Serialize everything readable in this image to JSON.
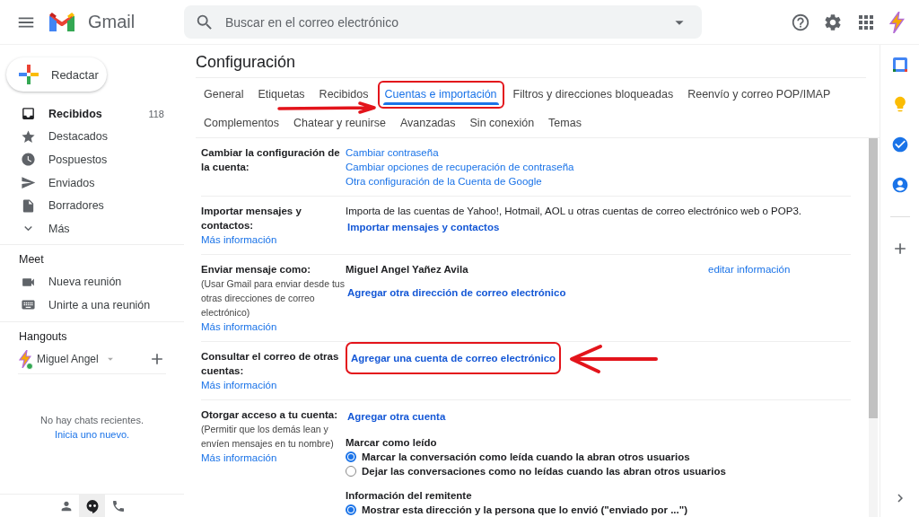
{
  "header": {
    "brand": "Gmail",
    "search": {
      "placeholder": "Buscar en el correo electrónico"
    }
  },
  "sidebar": {
    "compose": "Redactar",
    "items": [
      {
        "label": "Recibidos",
        "count": "118",
        "selected": true
      },
      {
        "label": "Destacados",
        "selected": false
      },
      {
        "label": "Pospuestos",
        "selected": false
      },
      {
        "label": "Enviados",
        "selected": false
      },
      {
        "label": "Borradores",
        "selected": false
      },
      {
        "label": "Más",
        "selected": false
      }
    ],
    "meet": {
      "title": "Meet",
      "items": [
        "Nueva reunión",
        "Unirte a una reunión"
      ]
    },
    "hangouts": {
      "title": "Hangouts",
      "user": "Miguel Angel",
      "online": true,
      "empty": "No hay chats recientes.",
      "start_link": "Inicia uno nuevo."
    },
    "bottom_tabs": [
      {
        "selected": false
      },
      {
        "selected": true
      },
      {
        "selected": false
      }
    ]
  },
  "page_title": "Configuración",
  "tab_rows": [
    [
      {
        "label": "General",
        "selected": false,
        "highlighted": false
      },
      {
        "label": "Etiquetas",
        "selected": false,
        "highlighted": false
      },
      {
        "label": "Recibidos",
        "selected": false,
        "highlighted": false
      },
      {
        "label": "Cuentas e importación",
        "selected": true,
        "highlighted": true
      },
      {
        "label": "Filtros y direcciones bloqueadas",
        "selected": false,
        "highlighted": false
      },
      {
        "label": "Reenvío y correo POP/IMAP",
        "selected": false,
        "highlighted": false
      }
    ],
    [
      {
        "label": "Complementos",
        "selected": false,
        "highlighted": false
      },
      {
        "label": "Chatear y reunirse",
        "selected": false,
        "highlighted": false
      },
      {
        "label": "Avanzadas",
        "selected": false,
        "highlighted": false
      },
      {
        "label": "Sin conexión",
        "selected": false,
        "highlighted": false
      },
      {
        "label": "Temas",
        "selected": false,
        "highlighted": false
      }
    ]
  ],
  "settings": [
    {
      "label": "Cambiar la configuración de la cuenta:",
      "values": [
        {
          "kind": "link",
          "text": "Cambiar contraseña"
        },
        {
          "kind": "link",
          "text": "Cambiar opciones de recuperación de contraseña"
        },
        {
          "kind": "link",
          "text": "Otra configuración de la Cuenta de Google"
        }
      ]
    },
    {
      "label": "Importar mensajes y contactos:",
      "more": "Más información",
      "values": [
        {
          "kind": "text",
          "text": "Importa de las cuentas de Yahoo!, Hotmail, AOL u otras cuentas de correo electrónico web o POP3."
        },
        {
          "kind": "strong_link",
          "text": "Importar mensajes y contactos"
        }
      ]
    },
    {
      "label": "Enviar mensaje como:",
      "note": "(Usar Gmail para enviar desde tus otras direcciones de correo electrónico)",
      "more": "Más información",
      "values": [
        {
          "kind": "sender",
          "text": "Miguel Angel Yañez Avila",
          "action": "editar información"
        },
        {
          "kind": "strong_link",
          "text": "Agregar otra dirección de correo electrónico"
        }
      ]
    },
    {
      "label": "Consultar el correo de otras cuentas:",
      "more": "Más información",
      "values": [
        {
          "kind": "strong_link",
          "text": "Agregar una cuenta de correo electrónico",
          "highlighted": true
        }
      ]
    },
    {
      "label": "Otorgar acceso a tu cuenta:",
      "note": "(Permitir que los demás lean y envíen mensajes en tu nombre)",
      "more": "Más información",
      "values": [
        {
          "kind": "strong_link",
          "text": "Agregar otra cuenta"
        },
        {
          "kind": "heading",
          "text": "Marcar como leído"
        },
        {
          "kind": "radio",
          "text": "Marcar la conversación como leída cuando la abran otros usuarios",
          "selected": true
        },
        {
          "kind": "radio",
          "text": "Dejar las conversaciones como no leídas cuando las abran otros usuarios",
          "selected": false
        },
        {
          "kind": "heading",
          "text": "Información del remitente"
        },
        {
          "kind": "radio",
          "text": "Mostrar esta dirección y la persona que lo envió (\"enviado por ...\")",
          "selected": true
        }
      ]
    }
  ]
}
